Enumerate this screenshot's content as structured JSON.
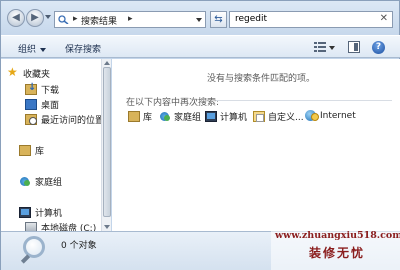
{
  "address_bar": {
    "breadcrumb": "搜索结果",
    "search_value": "regedit"
  },
  "toolbar": {
    "organize_label": "组织",
    "save_search_label": "保存搜索"
  },
  "nav_pane": {
    "items": [
      {
        "label": "收藏夹",
        "icon": "star-icon"
      },
      {
        "label": "下载",
        "icon": "downloads-folder-icon"
      },
      {
        "label": "桌面",
        "icon": "desktop-icon"
      },
      {
        "label": "最近访问的位置",
        "icon": "recent-places-icon"
      },
      {
        "label": "库",
        "icon": "library-icon"
      },
      {
        "label": "家庭组",
        "icon": "homegroup-icon"
      },
      {
        "label": "计算机",
        "icon": "computer-icon"
      },
      {
        "label": "本地磁盘 (C:)",
        "icon": "drive-icon"
      }
    ]
  },
  "content": {
    "empty_message": "没有与搜索条件匹配的项。",
    "search_again_label": "在以下内容中再次搜索:",
    "search_again_items": [
      {
        "label": "库",
        "icon": "library-icon"
      },
      {
        "label": "家庭组",
        "icon": "homegroup-icon"
      },
      {
        "label": "计算机",
        "icon": "computer-icon"
      },
      {
        "label": "自定义...",
        "icon": "custom-icon"
      },
      {
        "label": "Internet",
        "icon": "internet-icon"
      }
    ]
  },
  "details_pane": {
    "item_count": "0 个对象"
  },
  "watermark": {
    "url": "www.zhuangxiu518.com",
    "name": "装修无忧"
  },
  "colors": {
    "frame": "#c3d5ea",
    "watermark_text": "#8a1d1d"
  }
}
